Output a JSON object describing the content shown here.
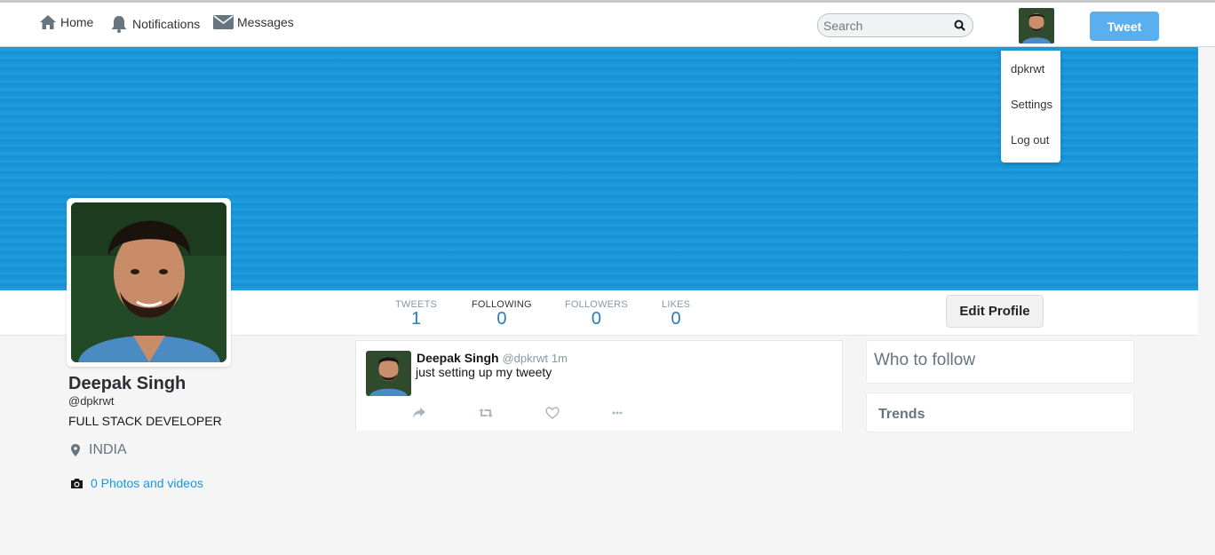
{
  "nav": {
    "home": "Home",
    "notifications": "Notifications",
    "messages": "Messages"
  },
  "search": {
    "placeholder": "Search"
  },
  "tweet_button": "Tweet",
  "dropdown": {
    "username": "dpkrwt",
    "settings": "Settings",
    "logout": "Log out"
  },
  "stats": [
    {
      "label": "TWEETS",
      "value": "1"
    },
    {
      "label": "FOLLOWING",
      "value": "0"
    },
    {
      "label": "FOLLOWERS",
      "value": "0"
    },
    {
      "label": "LIKES",
      "value": "0"
    }
  ],
  "edit_profile": "Edit Profile",
  "profile": {
    "name": "Deepak Singh",
    "handle": "@dpkrwt",
    "bio": "FULL STACK DEVELOPER",
    "location": "INDIA",
    "photos": "0 Photos and videos"
  },
  "tweet": {
    "name": "Deepak Singh",
    "handle": "@dpkrwt",
    "time": "1m",
    "text": "just setting up my tweety"
  },
  "sidebar": {
    "who_to_follow": "Who to follow",
    "trends": "Trends"
  },
  "colors": {
    "accent": "#1da1f2",
    "tweet_button": "#5aaff0",
    "banner": "#1795d8",
    "stat_value": "#2b7bb9",
    "link": "#1b95e0"
  }
}
